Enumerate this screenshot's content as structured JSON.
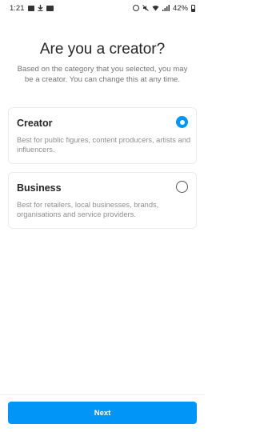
{
  "status_bar": {
    "time": "1:21",
    "battery": "42%",
    "left_icons": [
      "image-icon",
      "download-icon",
      "folder-icon"
    ],
    "right_icons": [
      "alarm-icon",
      "mute-icon",
      "wifi-icon",
      "signal-icon",
      "battery-icon"
    ]
  },
  "header": {
    "title": "Are you a creator?",
    "subtitle": "Based on the category that you selected, you may be a creator. You can change this at any time."
  },
  "options": [
    {
      "title": "Creator",
      "description": "Best for public figures, content producers, artists and influencers.",
      "selected": true
    },
    {
      "title": "Business",
      "description": "Best for retailers, local businesses, brands, organisations and service providers.",
      "selected": false
    }
  ],
  "footer": {
    "next_label": "Next"
  },
  "colors": {
    "accent": "#0095f6",
    "title_text": "#262626",
    "muted_text": "#8e8e8e"
  }
}
